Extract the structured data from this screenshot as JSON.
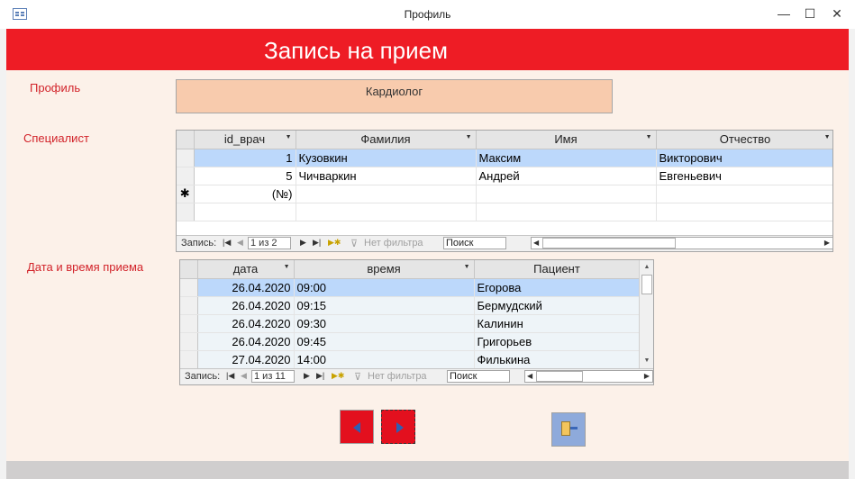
{
  "window": {
    "title": "Профиль",
    "minimize": "—",
    "maximize": "☐",
    "close": "✕"
  },
  "form": {
    "header": "Запись на прием"
  },
  "labels": {
    "profile": "Профиль",
    "specialist": "Специалист",
    "datetime": "Дата и время приема"
  },
  "profile_value": "Кардиолог",
  "specialists": {
    "columns": [
      "id_врач",
      "Фамилия",
      "Имя",
      "Отчество"
    ],
    "rows": [
      {
        "id": "1",
        "last": "Кузовкин",
        "first": "Максим",
        "middle": "Викторович"
      },
      {
        "id": "5",
        "last": "Чичваркин",
        "first": "Андрей",
        "middle": "Евгеньевич"
      }
    ],
    "new_row_id": "(№)",
    "new_row_marker": "✱",
    "nav": {
      "label": "Запись:",
      "position": "1 из 2",
      "filter": "Нет фильтра",
      "search": "Поиск"
    }
  },
  "appointments": {
    "columns": [
      "дата",
      "время",
      "Пациент"
    ],
    "rows": [
      {
        "date": "26.04.2020",
        "time": "09:00",
        "patient": "Егорова"
      },
      {
        "date": "26.04.2020",
        "time": "09:15",
        "patient": "Бермудский"
      },
      {
        "date": "26.04.2020",
        "time": "09:30",
        "patient": "Калинин"
      },
      {
        "date": "26.04.2020",
        "time": "09:45",
        "patient": "Григорьев"
      },
      {
        "date": "27.04.2020",
        "time": "14:00",
        "patient": "Филькина"
      }
    ],
    "nav": {
      "label": "Запись:",
      "position": "1 из 11",
      "filter": "Нет фильтра",
      "search": "Поиск"
    }
  },
  "colors": {
    "header": "#ee1c25",
    "form_bg": "#fcf1e9",
    "profile_box": "#f8cbad",
    "highlight": "#bcd8fb",
    "nav_button": "#e3101e",
    "nav_arrow": "#2e5fb3",
    "exit_button": "#8eaadb"
  },
  "icons": {
    "prev": "triangle-left",
    "next": "triangle-right",
    "exit": "door-exit-icon"
  }
}
